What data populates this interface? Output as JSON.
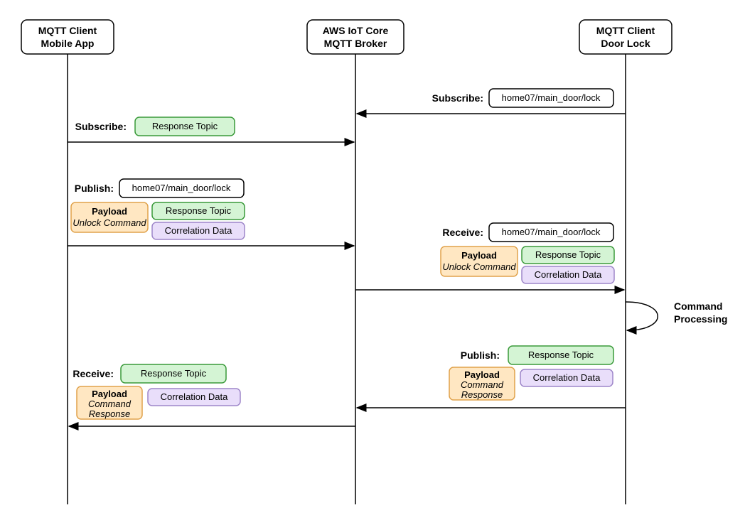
{
  "participants": {
    "mobile": {
      "line1": "MQTT Client",
      "line2": "Mobile App"
    },
    "broker": {
      "line1": "AWS IoT Core",
      "line2": "MQTT Broker"
    },
    "lock": {
      "line1": "MQTT Client",
      "line2": "Door Lock"
    }
  },
  "labels": {
    "subscribe": "Subscribe:",
    "publish": "Publish:",
    "receive": "Receive:",
    "responseTopic": "Response Topic",
    "correlationData": "Correlation Data",
    "payload": "Payload",
    "unlockCommand": "Unlock Command",
    "commandResponse": "Command",
    "commandResponse2": "Response",
    "topic": "home07/main_door/lock",
    "commandProcessing1": "Command",
    "commandProcessing2": "Processing"
  },
  "chart_data": {
    "type": "sequence-diagram",
    "participants": [
      "MQTT Client Mobile App",
      "AWS IoT Core MQTT Broker",
      "MQTT Client Door Lock"
    ],
    "messages": [
      {
        "from": "MQTT Client Door Lock",
        "to": "AWS IoT Core MQTT Broker",
        "action": "Subscribe",
        "topic": "home07/main_door/lock"
      },
      {
        "from": "MQTT Client Mobile App",
        "to": "AWS IoT Core MQTT Broker",
        "action": "Subscribe",
        "topic": "Response Topic"
      },
      {
        "from": "MQTT Client Mobile App",
        "to": "AWS IoT Core MQTT Broker",
        "action": "Publish",
        "topic": "home07/main_door/lock",
        "payload": "Unlock Command",
        "props": [
          "Response Topic",
          "Correlation Data"
        ]
      },
      {
        "from": "AWS IoT Core MQTT Broker",
        "to": "MQTT Client Door Lock",
        "action": "Receive",
        "topic": "home07/main_door/lock",
        "payload": "Unlock Command",
        "props": [
          "Response Topic",
          "Correlation Data"
        ]
      },
      {
        "from": "MQTT Client Door Lock",
        "to": "MQTT Client Door Lock",
        "action": "Command Processing"
      },
      {
        "from": "MQTT Client Door Lock",
        "to": "AWS IoT Core MQTT Broker",
        "action": "Publish",
        "topic": "Response Topic",
        "payload": "Command Response",
        "props": [
          "Correlation Data"
        ]
      },
      {
        "from": "AWS IoT Core MQTT Broker",
        "to": "MQTT Client Mobile App",
        "action": "Receive",
        "topic": "Response Topic",
        "payload": "Command Response",
        "props": [
          "Correlation Data"
        ]
      }
    ]
  }
}
